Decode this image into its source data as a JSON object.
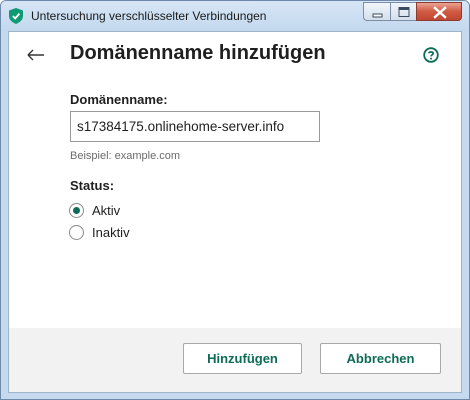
{
  "window": {
    "title": "Untersuchung verschlüsselter Verbindungen",
    "icon": "kaspersky-shield-icon"
  },
  "header": {
    "back_icon": "arrow-left-icon",
    "title": "Domänenname hinzufügen",
    "help_icon": "question-circle-icon"
  },
  "form": {
    "domain_label": "Domänenname:",
    "domain_value": "s17384175.onlinehome-server.info",
    "domain_hint": "Beispiel: example.com",
    "status_label": "Status:",
    "status_options": [
      {
        "label": "Aktiv",
        "selected": true
      },
      {
        "label": "Inaktiv",
        "selected": false
      }
    ]
  },
  "footer": {
    "add_label": "Hinzufügen",
    "cancel_label": "Abbrechen"
  },
  "colors": {
    "accent": "#0d6b57",
    "footer_bg": "#f2f2f2",
    "titlebar": "#c6daef"
  }
}
